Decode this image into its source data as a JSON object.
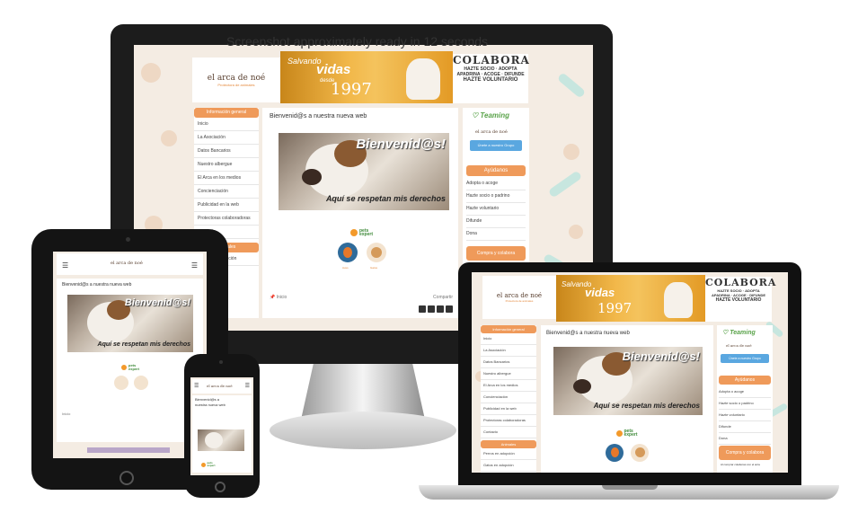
{
  "overlay_text": "Screenshot approximately ready in 12 seconds",
  "brand": {
    "logo_main": "el arca de noé",
    "logo_sub": "Protectora de animales",
    "banner_script": "Salvando",
    "banner_vidas": "vidas",
    "banner_desde": "desde",
    "banner_year": "1997",
    "colabora_title": "COLABORA",
    "colabora_line1": "HAZTE SOCIO · ADOPTA",
    "colabora_line2": "APADRINA · ACOGE · DIFUNDE",
    "colabora_line3": "HAZTE VOLUNTARIO"
  },
  "sidebar_left": {
    "header": "Información general",
    "items": [
      "Inicio",
      "La Asociación",
      "Datos Bancarios",
      "Nuestro albergue",
      "El Arca en los medios",
      "Concienciación",
      "Publicidad en la web",
      "Protectoras colaboradoras",
      "Contacto"
    ],
    "header2": "Animales",
    "items2": [
      "Perros en adopción",
      "Gatos en adopción"
    ]
  },
  "main": {
    "welcome_heading": "Bienvenid@s a nuestra nueva web",
    "photo_title": "Bienvenid@s!",
    "photo_caption": "Aquí se respetan mis derechos",
    "pets_expert": "pets expert",
    "pet_label_1": "Aves",
    "pet_label_2": "Gatos",
    "footer_left": "Inicio",
    "footer_right": "Compartir"
  },
  "sidebar_right": {
    "teaming": "Teaming",
    "teaming_button": "Únete a nuestro Grupo",
    "header": "Ayúdanos",
    "items": [
      "Adopta o acoge",
      "Hazte socio o padrino",
      "Hazte voluntario",
      "Difunde",
      "Dona"
    ],
    "compra_button": "Compra y colabora",
    "compra_note": "Al comprar colaboras con el arca"
  },
  "colors": {
    "orange": "#ef9a5a",
    "site_bg": "#f4ece3",
    "blue": "#5aa7e0",
    "green": "#3f8a3a"
  }
}
